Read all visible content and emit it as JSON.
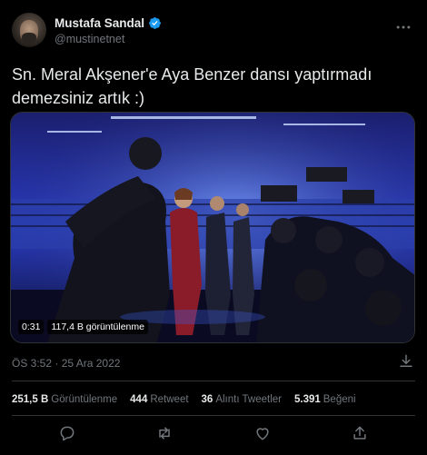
{
  "author": {
    "name": "Mustafa Sandal",
    "handle": "@mustinetnet"
  },
  "tweet": {
    "text_line1": "Sn. Meral Akşener'e Aya Benzer dansı yaptırmadı",
    "text_line2": "demezsiniz artık :)"
  },
  "video": {
    "duration": "0:31",
    "views": "117,4 B görüntülenme"
  },
  "meta": {
    "timestamp": "ÖS 3:52 · 25 Ara 2022"
  },
  "stats": {
    "views_count": "251,5 B",
    "views_label": "Görüntülenme",
    "retweets_count": "444",
    "retweets_label": "Retweet",
    "quotes_count": "36",
    "quotes_label": "Alıntı Tweetler",
    "likes_count": "5.391",
    "likes_label": "Beğeni"
  },
  "colors": {
    "background": "#000000",
    "text": "#e7e9ea",
    "muted": "#71767b",
    "verified": "#1d9bf0",
    "border": "#2f3336"
  },
  "icons": [
    "verified-badge-icon",
    "more-options-icon",
    "download-icon",
    "reply-icon",
    "retweet-icon",
    "like-icon",
    "share-icon"
  ]
}
